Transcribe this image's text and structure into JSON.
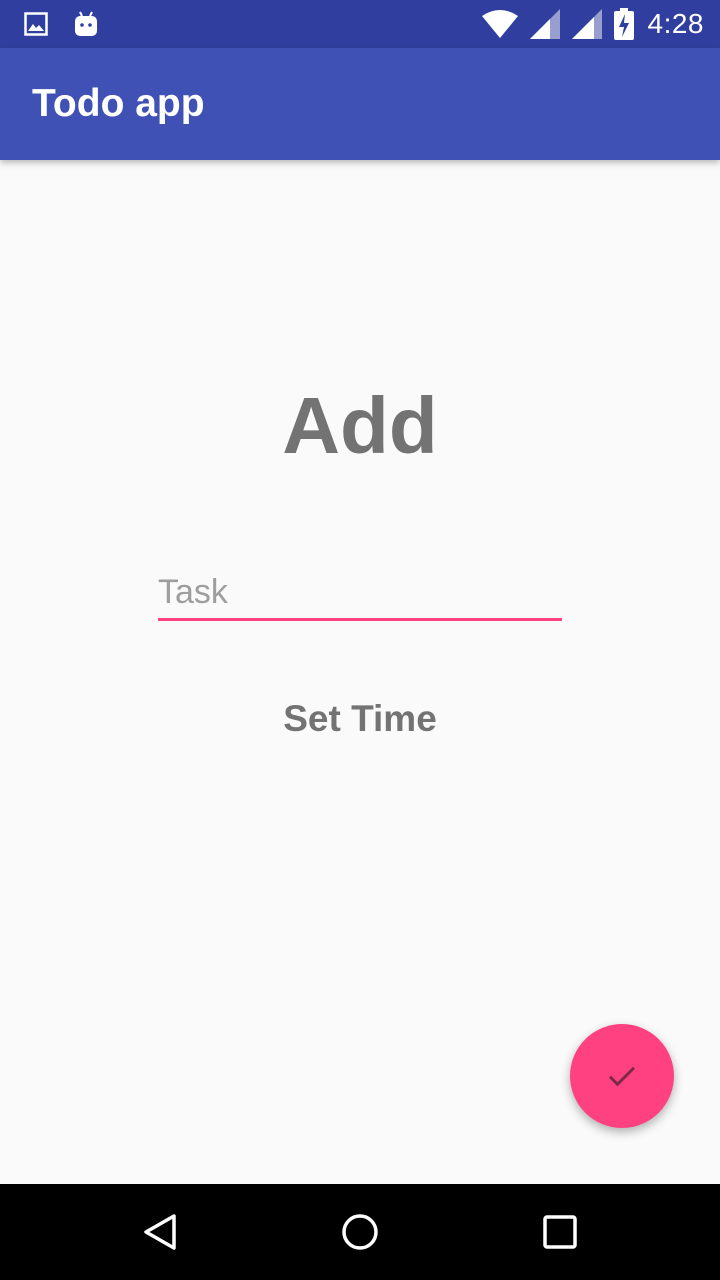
{
  "status_bar": {
    "time": "4:28",
    "icons_left": [
      "image-notification-icon",
      "android-notification-icon"
    ],
    "icons_right": [
      "wifi-icon",
      "signal-icon",
      "signal-icon",
      "battery-charging-icon"
    ],
    "background": "#303f9f"
  },
  "app_bar": {
    "title": "Todo app",
    "background": "#3f51b5"
  },
  "main": {
    "heading": "Add",
    "task_field": {
      "placeholder": "Task",
      "value": ""
    },
    "set_time_label": "Set Time",
    "accent": "#ff4081"
  },
  "fab": {
    "icon": "check-icon"
  },
  "nav_bar": {
    "buttons": [
      "back-icon",
      "home-icon",
      "recents-icon"
    ]
  }
}
